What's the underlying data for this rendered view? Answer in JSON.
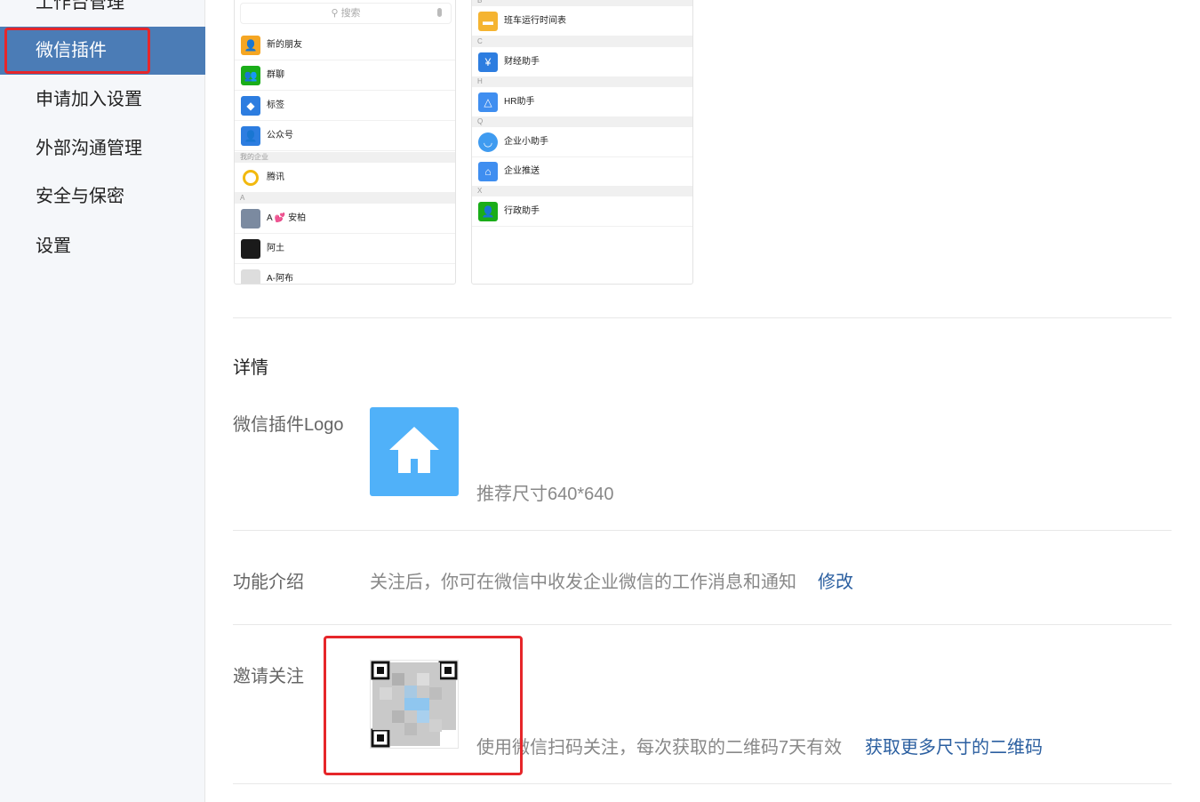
{
  "sidebar": {
    "items": [
      {
        "label": "工作台管理"
      },
      {
        "label": "微信插件"
      },
      {
        "label": "申请加入设置"
      },
      {
        "label": "外部沟通管理"
      },
      {
        "label": "安全与保密"
      },
      {
        "label": "设置"
      }
    ]
  },
  "preview_left": {
    "search_placeholder": "搜索",
    "rows": [
      {
        "label": "新的朋友",
        "icon": "add-friend-icon",
        "color": "#f5a623"
      },
      {
        "label": "群聊",
        "icon": "group-chat-icon",
        "color": "#1aad19"
      },
      {
        "label": "标签",
        "icon": "tag-icon",
        "color": "#2d7de0"
      },
      {
        "label": "公众号",
        "icon": "official-account-icon",
        "color": "#2d7de0"
      }
    ],
    "section_my_company": "我的企业",
    "company_row": {
      "label": "腾讯"
    },
    "section_a": "A",
    "contacts": [
      {
        "label": "A 💕 安柏"
      },
      {
        "label": "阿土"
      },
      {
        "label": "A-阿布"
      }
    ]
  },
  "preview_right": {
    "rows": [
      {
        "section": "B",
        "label": "班车运行时间表",
        "icon": "bus-schedule-icon",
        "color": "#f5b431"
      },
      {
        "section": "C",
        "label": "财经助手",
        "icon": "finance-icon",
        "color": "#2d7de0"
      },
      {
        "section": "H",
        "label": "HR助手",
        "icon": "hr-icon",
        "color": "#3f8ef0"
      },
      {
        "section": "Q",
        "label": "企业小助手",
        "icon": "assistant-icon",
        "color": "#3f9bf0"
      },
      {
        "section": "",
        "label": "企业推送",
        "icon": "home-icon",
        "color": "#3f8ef0"
      },
      {
        "section": "X",
        "label": "行政助手",
        "icon": "admin-icon",
        "color": "#1aad19"
      }
    ]
  },
  "details": {
    "heading": "详情",
    "logo_label": "微信插件Logo",
    "logo_hint": "推荐尺寸640*640",
    "intro_label": "功能介绍",
    "intro_text": "关注后，你可在微信中收发企业微信的工作消息和通知",
    "intro_edit": "修改",
    "invite_label": "邀请关注",
    "invite_text": "使用微信扫码关注，每次获取的二维码7天有效",
    "invite_link": "获取更多尺寸的二维码"
  },
  "colors": {
    "accent": "#4b7cb6",
    "logo_bg": "#50b1f9",
    "link": "#2b5fa0",
    "highlight": "#e6262a"
  }
}
